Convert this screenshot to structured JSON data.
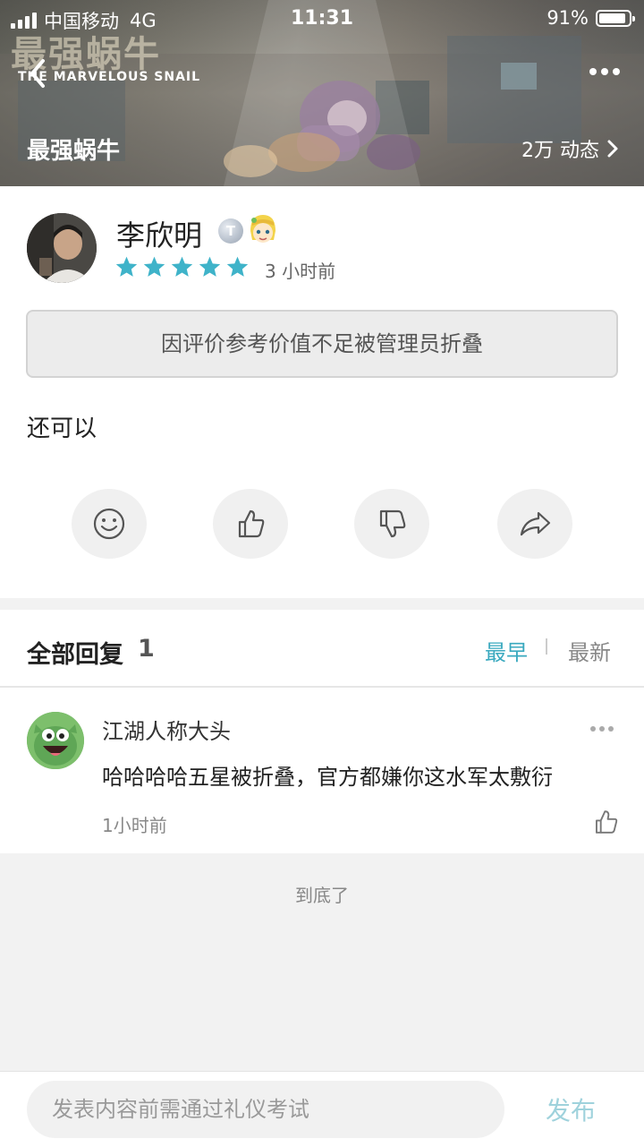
{
  "status_bar": {
    "carrier": "中国移动",
    "network": "4G",
    "time": "11:31",
    "battery": "91%",
    "battery_level": 0.91
  },
  "header": {
    "game_logo_cn": "最强蜗牛",
    "game_logo_en": "THE MARVELOUS SNAIL",
    "game_name": "最强蜗牛",
    "stat": "2万 动态",
    "icons": [
      "back-icon",
      "more-icon",
      "chevron-right-icon"
    ]
  },
  "review": {
    "author": "李欣明",
    "badge_letter": "T",
    "rating": 5,
    "rating_max": 5,
    "time": "3 小时前",
    "folded_notice": "因评价参考价值不足被管理员折叠",
    "text": "还可以",
    "actions": [
      "smile-icon",
      "thumbs-up-icon",
      "thumbs-down-icon",
      "share-icon"
    ]
  },
  "replies": {
    "title": "全部回复",
    "count": "1",
    "sort_early": "最早",
    "sort_new": "最新",
    "items": [
      {
        "name": "江湖人称大头",
        "text": "哈哈哈哈五星被折叠，官方都嫌你这水军太敷衍",
        "time": "1小时前"
      }
    ],
    "end_text": "到底了"
  },
  "composer": {
    "placeholder": "发表内容前需通过礼仪考试",
    "submit_label": "发布"
  },
  "colors": {
    "accent": "#3aa9bf",
    "star": "#3fb3c9",
    "publish_disabled": "#9fd2dc"
  }
}
